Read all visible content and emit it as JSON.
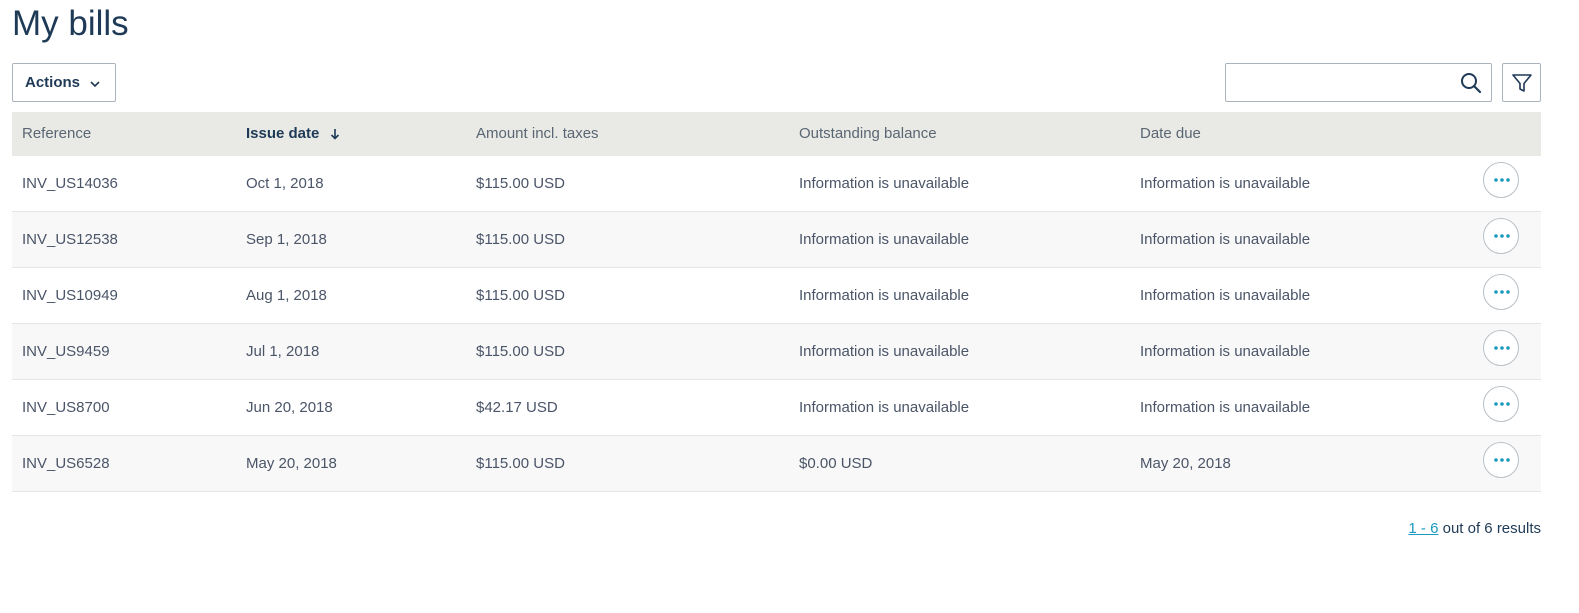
{
  "page": {
    "title": "My bills"
  },
  "toolbar": {
    "actions_label": "Actions",
    "search_placeholder": "",
    "search_value": ""
  },
  "table": {
    "columns": [
      {
        "label": "Reference",
        "sorted": false
      },
      {
        "label": "Issue date",
        "sorted": true,
        "sort_direction": "descending"
      },
      {
        "label": "Amount incl. taxes",
        "sorted": false
      },
      {
        "label": "Outstanding balance",
        "sorted": false
      },
      {
        "label": "Date due",
        "sorted": false
      }
    ],
    "rows": [
      {
        "reference": "INV_US14036",
        "issue_date": "Oct 1, 2018",
        "amount": "$115.00 USD",
        "balance": "Information is unavailable",
        "due": "Information is unavailable"
      },
      {
        "reference": "INV_US12538",
        "issue_date": "Sep 1, 2018",
        "amount": "$115.00 USD",
        "balance": "Information is unavailable",
        "due": "Information is unavailable"
      },
      {
        "reference": "INV_US10949",
        "issue_date": "Aug 1, 2018",
        "amount": "$115.00 USD",
        "balance": "Information is unavailable",
        "due": "Information is unavailable"
      },
      {
        "reference": "INV_US9459",
        "issue_date": "Jul 1, 2018",
        "amount": "$115.00 USD",
        "balance": "Information is unavailable",
        "due": "Information is unavailable"
      },
      {
        "reference": "INV_US8700",
        "issue_date": "Jun 20, 2018",
        "amount": "$42.17 USD",
        "balance": "Information is unavailable",
        "due": "Information is unavailable"
      },
      {
        "reference": "INV_US6528",
        "issue_date": "May 20, 2018",
        "amount": "$115.00 USD",
        "balance": "$0.00 USD",
        "due": "May 20, 2018"
      }
    ]
  },
  "pagination": {
    "range": "1 - 6",
    "suffix": "out of 6 results"
  },
  "colors": {
    "title": "#1f3a56",
    "header_bg": "#e9eae5",
    "accent": "#1a9ac0",
    "border": "#a9b4bf"
  },
  "icons": {
    "actions": "chevron-down-icon",
    "search": "search-icon",
    "filter": "filter-icon",
    "sort": "arrow-down-icon",
    "row_menu": "more-horizontal-icon"
  }
}
